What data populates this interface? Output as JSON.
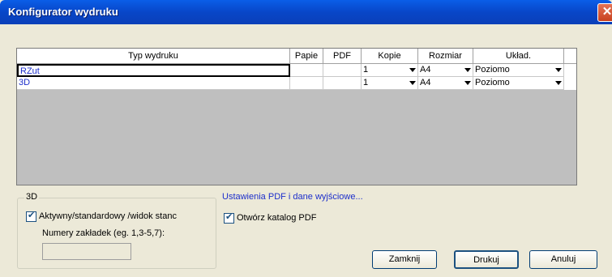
{
  "window": {
    "title": "Konfigurator wydruku"
  },
  "table": {
    "headers": [
      "Typ wydruku",
      "Papie",
      "PDF",
      "Kopie",
      "Rozmiar",
      "Układ."
    ],
    "rows": [
      {
        "name": "RZut",
        "kopie": "1",
        "rozmiar": "A4",
        "uklad": "Poziomo"
      },
      {
        "name": "3D",
        "kopie": "1",
        "rozmiar": "A4",
        "uklad": "Poziomo"
      }
    ]
  },
  "group3d": {
    "legend": "3D",
    "checkbox_label": "Aktywny/standardowy /widok stanc",
    "tabs_label": "Numery zakładek (eg. 1,3-5,7):",
    "tabs_value": ""
  },
  "pdf": {
    "link": "Ustawienia PDF i dane wyjściowe...",
    "open_catalog_label": "Otwórz katalog PDF"
  },
  "buttons": {
    "close": "Zamknij",
    "print": "Drukuj",
    "cancel": "Anuluj"
  }
}
